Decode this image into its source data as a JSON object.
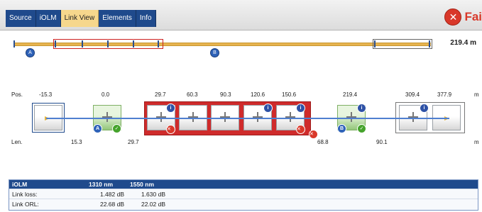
{
  "tabs": [
    "Source",
    "iOLM",
    "Link View",
    "Elements",
    "Info"
  ],
  "active_tab": "Link View",
  "status": {
    "label": "Fai",
    "icon": "x-icon"
  },
  "overview": {
    "total_length": "219.4 m"
  },
  "labels": {
    "pos": "Pos.",
    "len": "Len.",
    "unit_pos": "m",
    "unit_len": "m"
  },
  "positions": [
    "-15.3",
    "0.0",
    "29.7",
    "60.3",
    "90.3",
    "120.6",
    "150.6",
    "219.4",
    "309.4",
    "377.9"
  ],
  "lengths": [
    "15.3",
    "29.7",
    "68.8",
    "90.1"
  ],
  "badges": {
    "info": "i",
    "ok": "✓",
    "fail": "✕",
    "marker": "A",
    "marker_b": "B"
  },
  "table": {
    "headers": [
      "iOLM",
      "1310 nm",
      "1550 nm"
    ],
    "rows": [
      {
        "label": "Link loss:",
        "v1310": "1.482 dB",
        "v1550": "1.630 dB"
      },
      {
        "label": "Link ORL:",
        "v1310": "22.68 dB",
        "v1550": "22.02 dB"
      }
    ]
  },
  "colors": {
    "tab_bg": "#1f4a8c",
    "tab_active": "#f6d78c",
    "fail_red": "#d9382a",
    "pass_green": "#45a32c",
    "fiber": "#e7b44f",
    "link_line": "#4f7fd0"
  }
}
